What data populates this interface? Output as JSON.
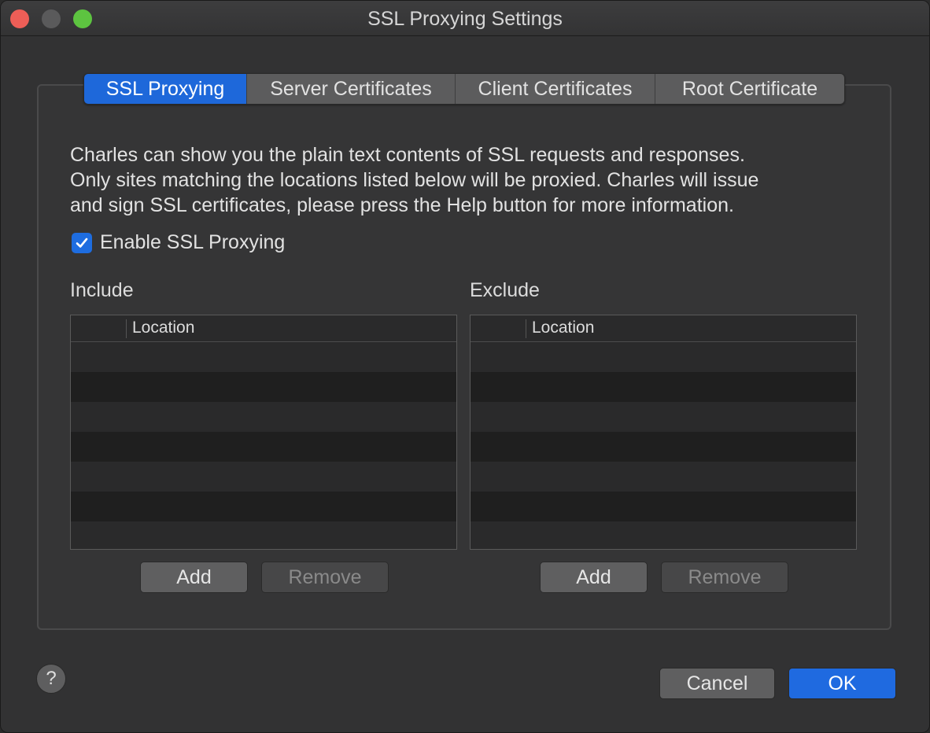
{
  "window": {
    "title": "SSL Proxying Settings"
  },
  "tabs": [
    {
      "label": "SSL Proxying",
      "active": true
    },
    {
      "label": "Server Certificates",
      "active": false
    },
    {
      "label": "Client Certificates",
      "active": false
    },
    {
      "label": "Root Certificate",
      "active": false
    }
  ],
  "description": {
    "lines": [
      "Charles can show you the plain text contents of SSL requests and responses.",
      "Only sites matching the locations listed below will be proxied. Charles will issue",
      "and sign SSL certificates, please press the Help button for more information."
    ]
  },
  "enable_ssl": {
    "label": "Enable SSL Proxying",
    "checked": true
  },
  "include": {
    "label": "Include",
    "column": "Location",
    "rows": [],
    "add_label": "Add",
    "remove_label": "Remove"
  },
  "exclude": {
    "label": "Exclude",
    "column": "Location",
    "rows": [],
    "add_label": "Add",
    "remove_label": "Remove"
  },
  "footer": {
    "help_label": "?",
    "cancel_label": "Cancel",
    "ok_label": "OK"
  },
  "colors": {
    "accent": "#1e68da",
    "background": "#323233"
  }
}
